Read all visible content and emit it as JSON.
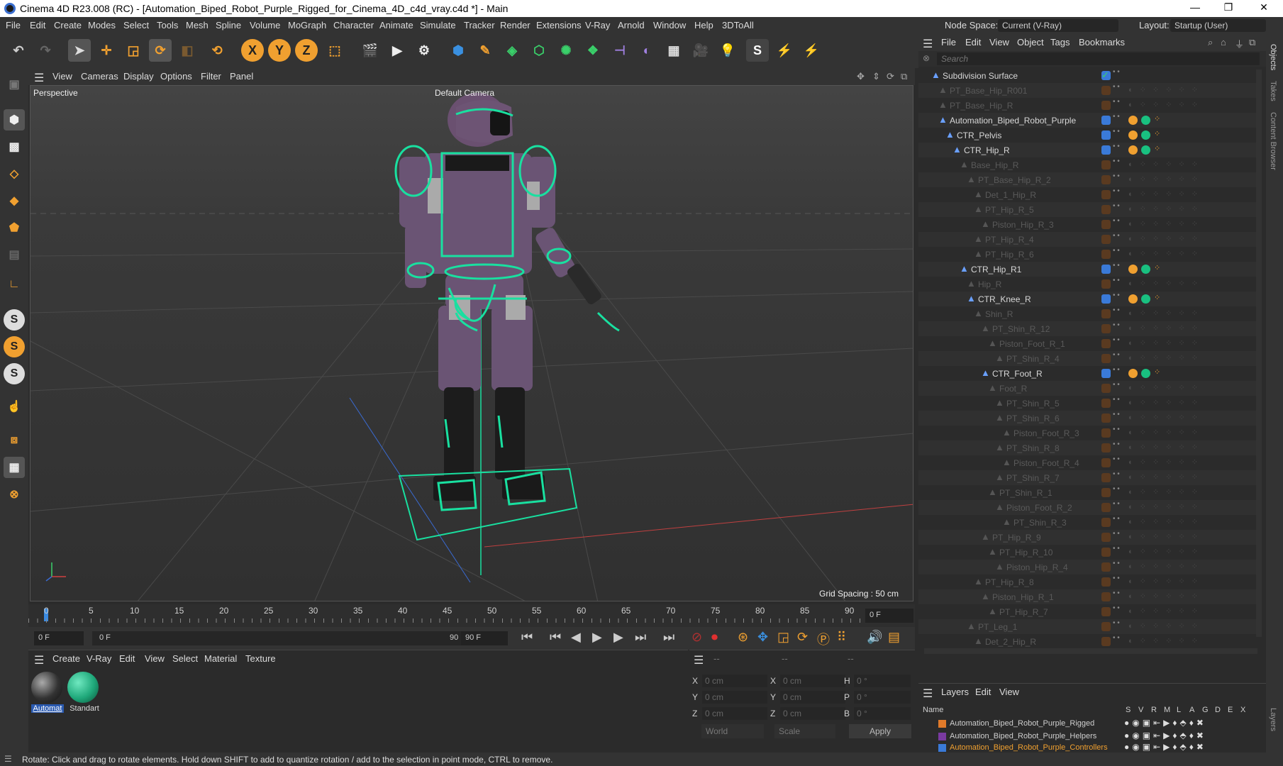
{
  "titlebar": {
    "title": "Cinema 4D R23.008 (RC) - [Automation_Biped_Robot_Purple_Rigged_for_Cinema_4D_c4d_vray.c4d *] - Main",
    "min": "—",
    "max": "❐",
    "close": "✕"
  },
  "menu": [
    "File",
    "Edit",
    "Create",
    "Modes",
    "Select",
    "Tools",
    "Mesh",
    "Spline",
    "Volume",
    "MoGraph",
    "Character",
    "Animate",
    "Simulate",
    "Tracker",
    "Render",
    "Extensions",
    "V-Ray",
    "Arnold",
    "Window",
    "Help",
    "3DToAll"
  ],
  "nodespace": {
    "label": "Node Space:",
    "value": "Current (V-Ray)"
  },
  "layout": {
    "label": "Layout:",
    "value": "Startup (User)"
  },
  "viewport": {
    "menu": [
      "View",
      "Cameras",
      "Display",
      "Options",
      "Filter",
      "Panel"
    ],
    "label": "Perspective",
    "camera": "Default Camera",
    "grid_spacing": "Grid Spacing : 50 cm"
  },
  "timeline": {
    "ticks": [
      "0",
      "5",
      "10",
      "15",
      "20",
      "25",
      "30",
      "35",
      "40",
      "45",
      "50",
      "55",
      "60",
      "65",
      "70",
      "75",
      "80",
      "85",
      "90"
    ],
    "frame_field": "0 F"
  },
  "transport": {
    "start": "0 F",
    "range_start": "0 F",
    "range_end": "90 F",
    "end": "90 F"
  },
  "material_manager": {
    "menu": [
      "Create",
      "V-Ray",
      "Edit",
      "View",
      "Select",
      "Material",
      "Texture"
    ],
    "materials": [
      {
        "name": "Automat",
        "color": "#4a4a4a"
      },
      {
        "name": "Standart",
        "color": "#1fa87a"
      }
    ]
  },
  "coords": {
    "header": [
      "--",
      "--",
      "--"
    ],
    "rows": [
      {
        "a": "X",
        "av": "0 cm",
        "b": "X",
        "bv": "0 cm",
        "c": "H",
        "cv": "0 °"
      },
      {
        "a": "Y",
        "av": "0 cm",
        "b": "Y",
        "bv": "0 cm",
        "c": "P",
        "cv": "0 °"
      },
      {
        "a": "Z",
        "av": "0 cm",
        "b": "Z",
        "bv": "0 cm",
        "c": "B",
        "cv": "0 °"
      }
    ],
    "world": "World",
    "scale": "Scale",
    "apply": "Apply"
  },
  "object_manager": {
    "menu": [
      "File",
      "Edit",
      "View",
      "Object",
      "Tags",
      "Bookmarks"
    ],
    "search_placeholder": "Search",
    "objects": [
      {
        "name": "Subdivision Surface",
        "dim": false
      },
      {
        "name": "PT_Base_Hip_R001",
        "dim": true
      },
      {
        "name": "PT_Base_Hip_R",
        "dim": true
      },
      {
        "name": "Automation_Biped_Robot_Purple",
        "dim": false
      },
      {
        "name": "CTR_Pelvis",
        "dim": false
      },
      {
        "name": "CTR_Hip_R",
        "dim": false
      },
      {
        "name": "Base_Hip_R",
        "dim": true
      },
      {
        "name": "PT_Base_Hip_R_2",
        "dim": true
      },
      {
        "name": "Det_1_Hip_R",
        "dim": true
      },
      {
        "name": "PT_Hip_R_5",
        "dim": true
      },
      {
        "name": "Piston_Hip_R_3",
        "dim": true
      },
      {
        "name": "PT_Hip_R_4",
        "dim": true
      },
      {
        "name": "PT_Hip_R_6",
        "dim": true
      },
      {
        "name": "CTR_Hip_R1",
        "dim": false
      },
      {
        "name": "Hip_R",
        "dim": true
      },
      {
        "name": "CTR_Knee_R",
        "dim": false
      },
      {
        "name": "Shin_R",
        "dim": true
      },
      {
        "name": "PT_Shin_R_12",
        "dim": true
      },
      {
        "name": "Piston_Foot_R_1",
        "dim": true
      },
      {
        "name": "PT_Shin_R_4",
        "dim": true
      },
      {
        "name": "CTR_Foot_R",
        "dim": false
      },
      {
        "name": "Foot_R",
        "dim": true
      },
      {
        "name": "PT_Shin_R_5",
        "dim": true
      },
      {
        "name": "PT_Shin_R_6",
        "dim": true
      },
      {
        "name": "Piston_Foot_R_3",
        "dim": true
      },
      {
        "name": "PT_Shin_R_8",
        "dim": true
      },
      {
        "name": "Piston_Foot_R_4",
        "dim": true
      },
      {
        "name": "PT_Shin_R_7",
        "dim": true
      },
      {
        "name": "PT_Shin_R_1",
        "dim": true
      },
      {
        "name": "Piston_Foot_R_2",
        "dim": true
      },
      {
        "name": "PT_Shin_R_3",
        "dim": true
      },
      {
        "name": "PT_Hip_R_9",
        "dim": true
      },
      {
        "name": "PT_Hip_R_10",
        "dim": true
      },
      {
        "name": "Piston_Hip_R_4",
        "dim": true
      },
      {
        "name": "PT_Hip_R_8",
        "dim": true
      },
      {
        "name": "Piston_Hip_R_1",
        "dim": true
      },
      {
        "name": "PT_Hip_R_7",
        "dim": true
      },
      {
        "name": "PT_Leg_1",
        "dim": true
      },
      {
        "name": "Det_2_Hip_R",
        "dim": true
      }
    ]
  },
  "layers": {
    "menu": [
      "Layers",
      "Edit",
      "View"
    ],
    "columns": [
      "Name",
      "S",
      "V",
      "R",
      "M",
      "L",
      "A",
      "G",
      "D",
      "E",
      "X"
    ],
    "items": [
      {
        "name": "Automation_Biped_Robot_Purple_Rigged",
        "color": "#e07a2a"
      },
      {
        "name": "Automation_Biped_Robot_Purple_Helpers",
        "color": "#7a3aa0"
      },
      {
        "name": "Automation_Biped_Robot_Purple_Controllers",
        "color": "#3a7ad8"
      }
    ]
  },
  "right_tabs": [
    "Objects",
    "Takes",
    "Content Browser",
    "Layers"
  ],
  "status": "Rotate: Click and drag to rotate elements. Hold down SHIFT to add to quantize rotation / add to the selection in point mode, CTRL to remove.",
  "colors": {
    "accent": "#2aa0ff",
    "controller": "#19e0a0",
    "robot": "#7a5a80"
  }
}
